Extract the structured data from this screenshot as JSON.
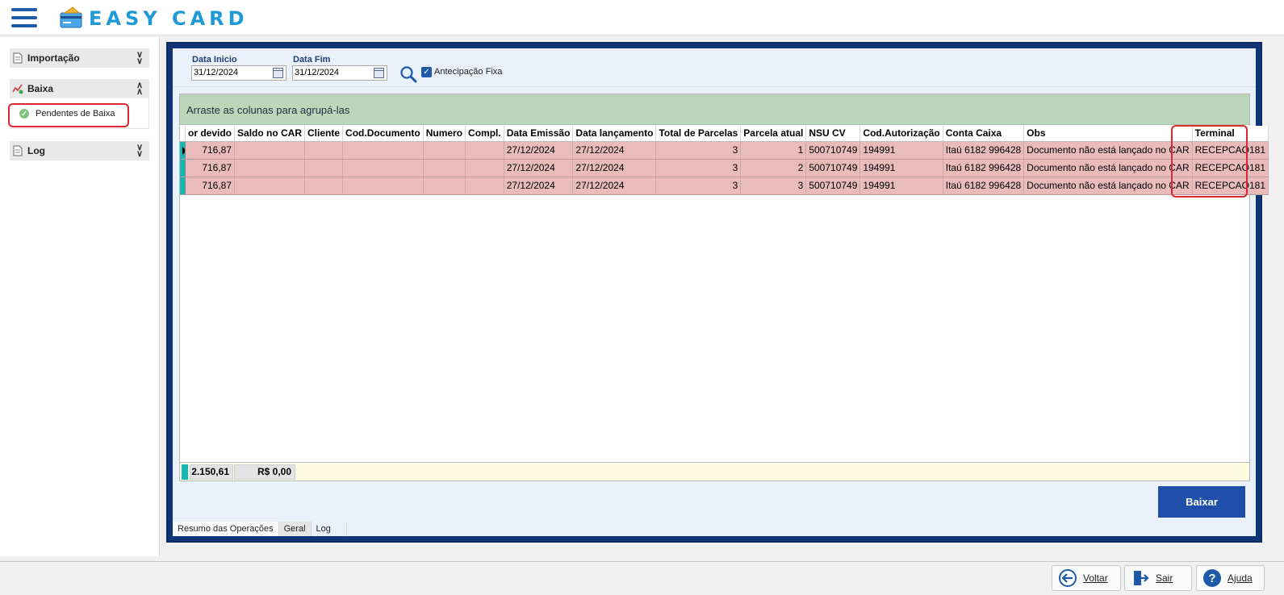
{
  "app": {
    "title": "EASY CARD"
  },
  "sidebar": {
    "sections": [
      {
        "label": "Importação",
        "expanded": false
      },
      {
        "label": "Baixa",
        "expanded": true,
        "items": [
          {
            "label": "Pendentes de Baixa"
          }
        ]
      },
      {
        "label": "Log",
        "expanded": false
      }
    ]
  },
  "filters": {
    "data_inicio_label": "Data Inicio",
    "data_inicio_value": "31/12/2024",
    "data_fim_label": "Data Fim",
    "data_fim_value": "31/12/2024",
    "antecipacao_label": "Antecipação Fixa",
    "antecipacao_checked": true
  },
  "grid": {
    "group_hint": "Arraste as colunas para agrupá-las",
    "columns": [
      "or devido",
      "Saldo no CAR",
      "Cliente",
      "Cod.Documento",
      "Numero",
      "Compl.",
      "Data Emissão",
      "Data lançamento",
      "Total de Parcelas",
      "Parcela atual",
      "NSU CV",
      "Cod.Autorização",
      "Conta Caixa",
      "Obs",
      "Terminal"
    ],
    "rows": [
      [
        "716,87",
        "",
        "",
        "",
        "",
        "",
        "27/12/2024",
        "27/12/2024",
        "3",
        "1",
        "500710749",
        "194991",
        "Itaú 6182 996428",
        "Documento não está lançado no CAR",
        "RECEPCAO181"
      ],
      [
        "716,87",
        "",
        "",
        "",
        "",
        "",
        "27/12/2024",
        "27/12/2024",
        "3",
        "2",
        "500710749",
        "194991",
        "Itaú 6182 996428",
        "Documento não está lançado no CAR",
        "RECEPCAO181"
      ],
      [
        "716,87",
        "",
        "",
        "",
        "",
        "",
        "27/12/2024",
        "27/12/2024",
        "3",
        "3",
        "500710749",
        "194991",
        "Itaú 6182 996428",
        "Documento não está lançado no CAR",
        "RECEPCAO181"
      ]
    ],
    "summary": {
      "total": "2.150,61",
      "saldo": "R$ 0,00"
    }
  },
  "actions": {
    "baixar_label": "Baixar"
  },
  "tabs": [
    "Resumo das Operações",
    "Geral",
    "Log"
  ],
  "bottom_buttons": {
    "voltar": "Voltar",
    "sair": "Sair",
    "ajuda": "Ajuda"
  },
  "colors": {
    "accent": "#1e5aa8",
    "frame": "#0f3576",
    "row_bg": "#e9bbbb",
    "group_bar": "#bad7b9",
    "row_indicator": "#12b8b4",
    "highlight_box": "#e0262f"
  },
  "icons": [
    "menu-icon",
    "card-logo-icon",
    "document-icon",
    "chart-icon",
    "check-icon",
    "search-icon",
    "calendar-icon",
    "back-arrow-icon",
    "exit-door-icon",
    "help-icon"
  ]
}
